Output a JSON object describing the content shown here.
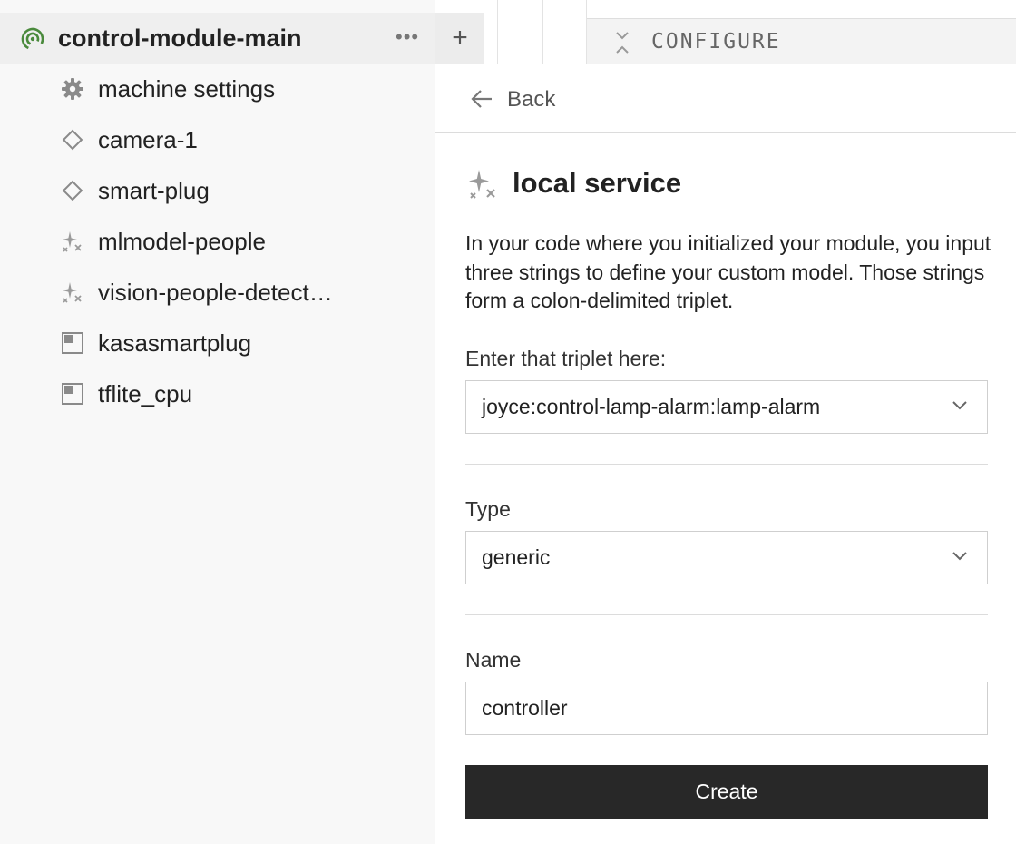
{
  "sidebar": {
    "machine": {
      "name": "control-module-main",
      "status_color": "#4a8a3c",
      "menu_label": "•••",
      "add_label": "+"
    },
    "items": [
      {
        "label": "machine settings",
        "icon": "gear-icon"
      },
      {
        "label": "camera-1",
        "icon": "diamond-icon"
      },
      {
        "label": "smart-plug",
        "icon": "diamond-icon"
      },
      {
        "label": "mlmodel-people",
        "icon": "sparkle-icon"
      },
      {
        "label": "vision-people-detect…",
        "icon": "sparkle-icon"
      },
      {
        "label": "kasasmartplug",
        "icon": "module-icon"
      },
      {
        "label": "tflite_cpu",
        "icon": "module-icon"
      }
    ]
  },
  "header": {
    "configure_label": "CONFIGURE"
  },
  "panel": {
    "back_label": "Back",
    "title": "local service",
    "description": "In your code where you initialized your module, you input three strings to define your custom model. Those strings form a colon-delimited triplet.",
    "triplet": {
      "label": "Enter that triplet here:",
      "value": "joyce:control-lamp-alarm:lamp-alarm"
    },
    "type": {
      "label": "Type",
      "value": "generic"
    },
    "name": {
      "label": "Name",
      "value": "controller"
    },
    "create_label": "Create"
  }
}
